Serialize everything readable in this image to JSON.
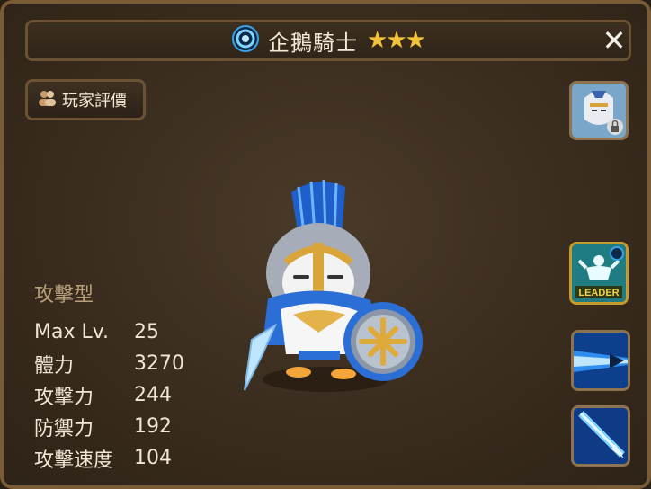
{
  "header": {
    "monster_name": "企鵝騎士",
    "stars": "★★★",
    "element_icon": "water-element-icon",
    "close_label": "✕"
  },
  "review_button": {
    "label": "玩家評價",
    "icon": "players-icon"
  },
  "monster": {
    "portrait": "penguin-knight-figure"
  },
  "stats": {
    "type": "攻擊型",
    "rows": [
      {
        "label": "Max Lv.",
        "value": "25"
      },
      {
        "label": "體力",
        "value": "3270"
      },
      {
        "label": "攻擊力",
        "value": "244"
      },
      {
        "label": "防禦力",
        "value": "192"
      },
      {
        "label": "攻擊速度",
        "value": "104"
      }
    ]
  },
  "side_slots": {
    "awakened_label": "locked-awakened-form",
    "leader_label": "LEADER",
    "skill1": "skill-1-icon",
    "skill2": "skill-2-icon"
  },
  "colors": {
    "frame": "#7a5c36",
    "title_text": "#f3ead6",
    "star": "#f2c23a",
    "type_text": "#b9a07a",
    "leader_bg": "#1f7c82",
    "skill_blue": "#1c6fd6"
  }
}
